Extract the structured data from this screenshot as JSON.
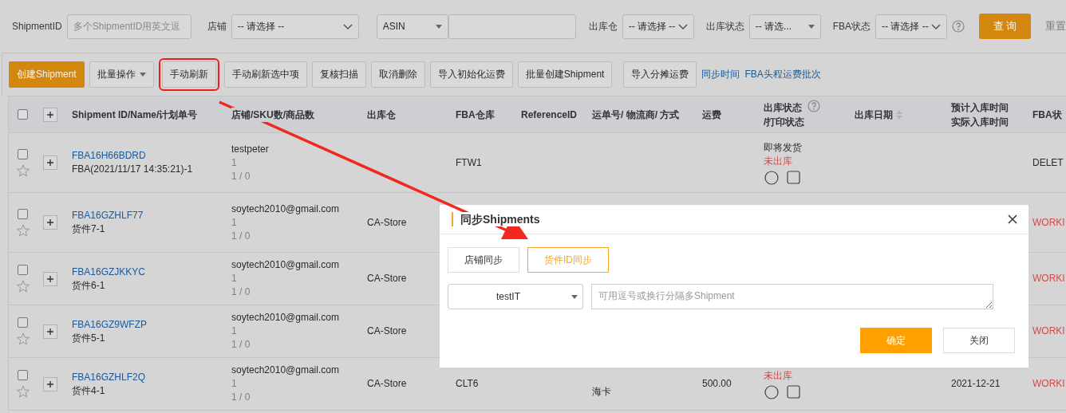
{
  "filters": {
    "shipment_id": {
      "label": "ShipmentID",
      "placeholder": "多个ShipmentID用英文逗"
    },
    "store": {
      "label": "店铺",
      "value": "-- 请选择 --"
    },
    "asin": {
      "value": "ASIN"
    },
    "warehouse": {
      "label": "出库仓",
      "value": "-- 请选择 --"
    },
    "outbound_status": {
      "label": "出库状态",
      "value": "-- 请选..."
    },
    "fba_status": {
      "label": "FBA状态",
      "value": "-- 请选择 --"
    },
    "search_button": "查 询",
    "reset_button": "重置"
  },
  "toolbar": [
    {
      "label": "创建Shipment",
      "kind": "primary",
      "highlighted": false
    },
    {
      "label": "批量操作",
      "kind": "dropdown",
      "highlighted": false
    },
    {
      "label": "手动刷新",
      "kind": "button",
      "highlighted": true
    },
    {
      "label": "手动刷新选中项",
      "kind": "button",
      "highlighted": false
    },
    {
      "label": "复核扫描",
      "kind": "button",
      "highlighted": false
    },
    {
      "label": "取消删除",
      "kind": "button",
      "highlighted": false
    },
    {
      "label": "导入初始化运费",
      "kind": "button",
      "highlighted": false
    },
    {
      "label": "批量创建Shipment",
      "kind": "button",
      "highlighted": false
    },
    {
      "label": "导入分摊运费",
      "kind": "button",
      "highlighted": false
    },
    {
      "label": "同步时间",
      "kind": "link",
      "highlighted": false
    },
    {
      "label": "FBA头程运费批次",
      "kind": "link",
      "highlighted": false
    }
  ],
  "table": {
    "select_all_checked": false,
    "columns": [
      {
        "label": "Shipment ID/Name/计划单号",
        "kind": "plain"
      },
      {
        "label": "店铺/SKU数/商品数",
        "kind": "plain"
      },
      {
        "label": "出库仓",
        "kind": "plain"
      },
      {
        "label": "FBA仓库",
        "kind": "plain"
      },
      {
        "label": "ReferenceID",
        "kind": "plain"
      },
      {
        "label": "运单号/ 物流商/ 方式",
        "kind": "plain"
      },
      {
        "label": "运费",
        "kind": "plain"
      },
      {
        "lines": [
          "出库状态",
          "/打印状态"
        ],
        "kind": "help"
      },
      {
        "label": "出库日期",
        "kind": "sort"
      },
      {
        "lines": [
          "预计入库时间",
          "实际入库时间"
        ],
        "kind": "plain"
      },
      {
        "label": "FBA状",
        "kind": "plain"
      }
    ],
    "rows": [
      {
        "checked": false,
        "starred": false,
        "shipment_id": "FBA16H66BDRD",
        "name": "FBA(2021/11/17 14:35:21)-1",
        "store": "testpeter",
        "sku_count": "1",
        "item_count": "1 / 0",
        "warehouse": "",
        "fba_warehouse": "FTW1",
        "carrier": "",
        "freight": "",
        "ship_status": "即将发货",
        "outbound_status": "未出库",
        "print_icons": true,
        "est_date": "",
        "fba_status": {
          "text": "DELET",
          "color": "#2a2a2a"
        }
      },
      {
        "checked": false,
        "starred": false,
        "shipment_id": "FBA16GZHLF77",
        "name": "货件7-1",
        "store": "soytech2010@gmail.com",
        "sku_count": "1",
        "item_count": "1 / 0",
        "warehouse": "CA-Store",
        "fba_warehouse": "",
        "carrier": "",
        "freight": "",
        "ship_status": "",
        "outbound_status": "",
        "est_date": "",
        "fba_status": {
          "text": "WORKI",
          "color": "#cc4c4c"
        }
      },
      {
        "checked": false,
        "starred": false,
        "shipment_id": "FBA16GZJKKYC",
        "name": "货件6-1",
        "store": "soytech2010@gmail.com",
        "sku_count": "1",
        "item_count": "1 / 0",
        "warehouse": "CA-Store",
        "fba_warehouse": "",
        "carrier": "",
        "freight": "",
        "ship_status": "",
        "outbound_status": "",
        "est_date": "",
        "fba_status": {
          "text": "WORKI",
          "color": "#cc4c4c"
        }
      },
      {
        "checked": false,
        "starred": false,
        "shipment_id": "FBA16GZ9WFZP",
        "name": "货件5-1",
        "store": "soytech2010@gmail.com",
        "sku_count": "1",
        "item_count": "1 / 0",
        "warehouse": "CA-Store",
        "fba_warehouse": "",
        "carrier": "",
        "freight": "",
        "ship_status": "",
        "outbound_status": "",
        "est_date": "",
        "fba_status": {
          "text": "WORKI",
          "color": "#cc4c4c"
        }
      },
      {
        "checked": false,
        "starred": false,
        "shipment_id": "FBA16GZHLF2Q",
        "name": "货件4-1",
        "store": "soytech2010@gmail.com",
        "sku_count": "1",
        "item_count": "1 / 0",
        "warehouse": "CA-Store",
        "fba_warehouse": "CLT6",
        "carrier": "海卡",
        "freight": "500.00",
        "ship_status": "",
        "outbound_status": "未出库",
        "print_icons": true,
        "est_date": "2021-12-21",
        "fba_status": {
          "text": "WORKI",
          "color": "#cc4c4c"
        }
      }
    ]
  },
  "dialog": {
    "title": "同步Shipments",
    "tabs": [
      {
        "label": "店铺同步",
        "selected": false
      },
      {
        "label": "货件ID同步",
        "selected": true
      }
    ],
    "store_select": "testIT",
    "ids_placeholder": "可用逗号或换行分隔多Shipment",
    "confirm_button": "确定",
    "close_button": "关闭"
  }
}
